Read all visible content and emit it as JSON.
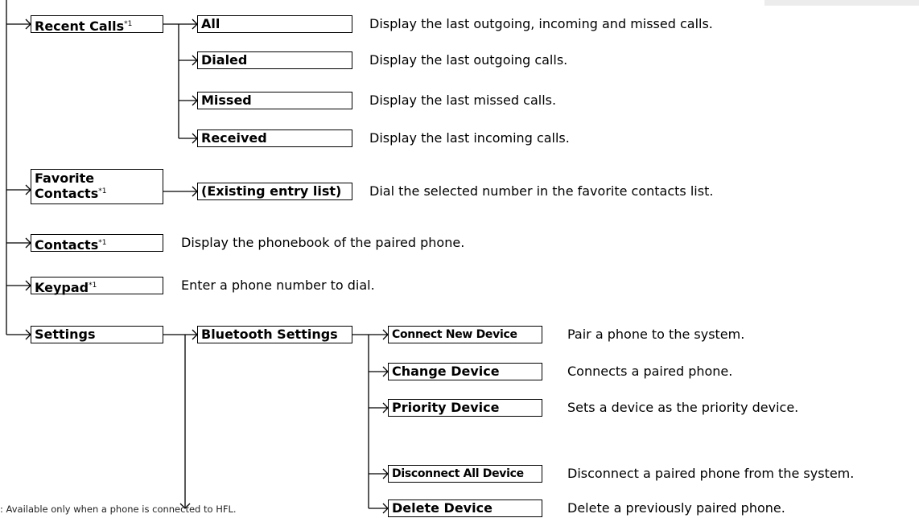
{
  "footnote": ": Available only when a phone is connected to HFL.",
  "items": {
    "recent_calls": {
      "label": "Recent Calls",
      "note": "*1"
    },
    "all": {
      "label": "All",
      "desc": "Display the last outgoing, incoming and missed calls."
    },
    "dialed": {
      "label": "Dialed",
      "desc": "Display the last outgoing calls."
    },
    "missed": {
      "label": "Missed",
      "desc": "Display the last missed calls."
    },
    "received": {
      "label": "Received",
      "desc": "Display the last incoming calls."
    },
    "favorite_contacts": {
      "label_line1": "Favorite",
      "label_line2": "Contacts",
      "note": "*1"
    },
    "existing_entry_list": {
      "label": "(Existing entry list)",
      "desc": "Dial the selected number in the favorite contacts list."
    },
    "contacts": {
      "label": "Contacts",
      "note": "*1",
      "desc": "Display the phonebook of the paired phone."
    },
    "keypad": {
      "label": "Keypad",
      "note": "*1",
      "desc": "Enter a phone number to dial."
    },
    "settings": {
      "label": "Settings"
    },
    "bluetooth_settings": {
      "label": "Bluetooth Settings"
    },
    "connect_new_device": {
      "label": "Connect New Device",
      "desc": "Pair a phone to the system."
    },
    "change_device": {
      "label": "Change Device",
      "desc": "Connects a paired phone."
    },
    "priority_device": {
      "label": "Priority Device",
      "desc": "Sets a device as the priority device."
    },
    "disconnect_all_device": {
      "label": "Disconnect All Device",
      "desc": "Disconnect a paired phone from the system."
    },
    "delete_device": {
      "label": "Delete Device",
      "desc": "Delete a previously paired phone."
    }
  }
}
